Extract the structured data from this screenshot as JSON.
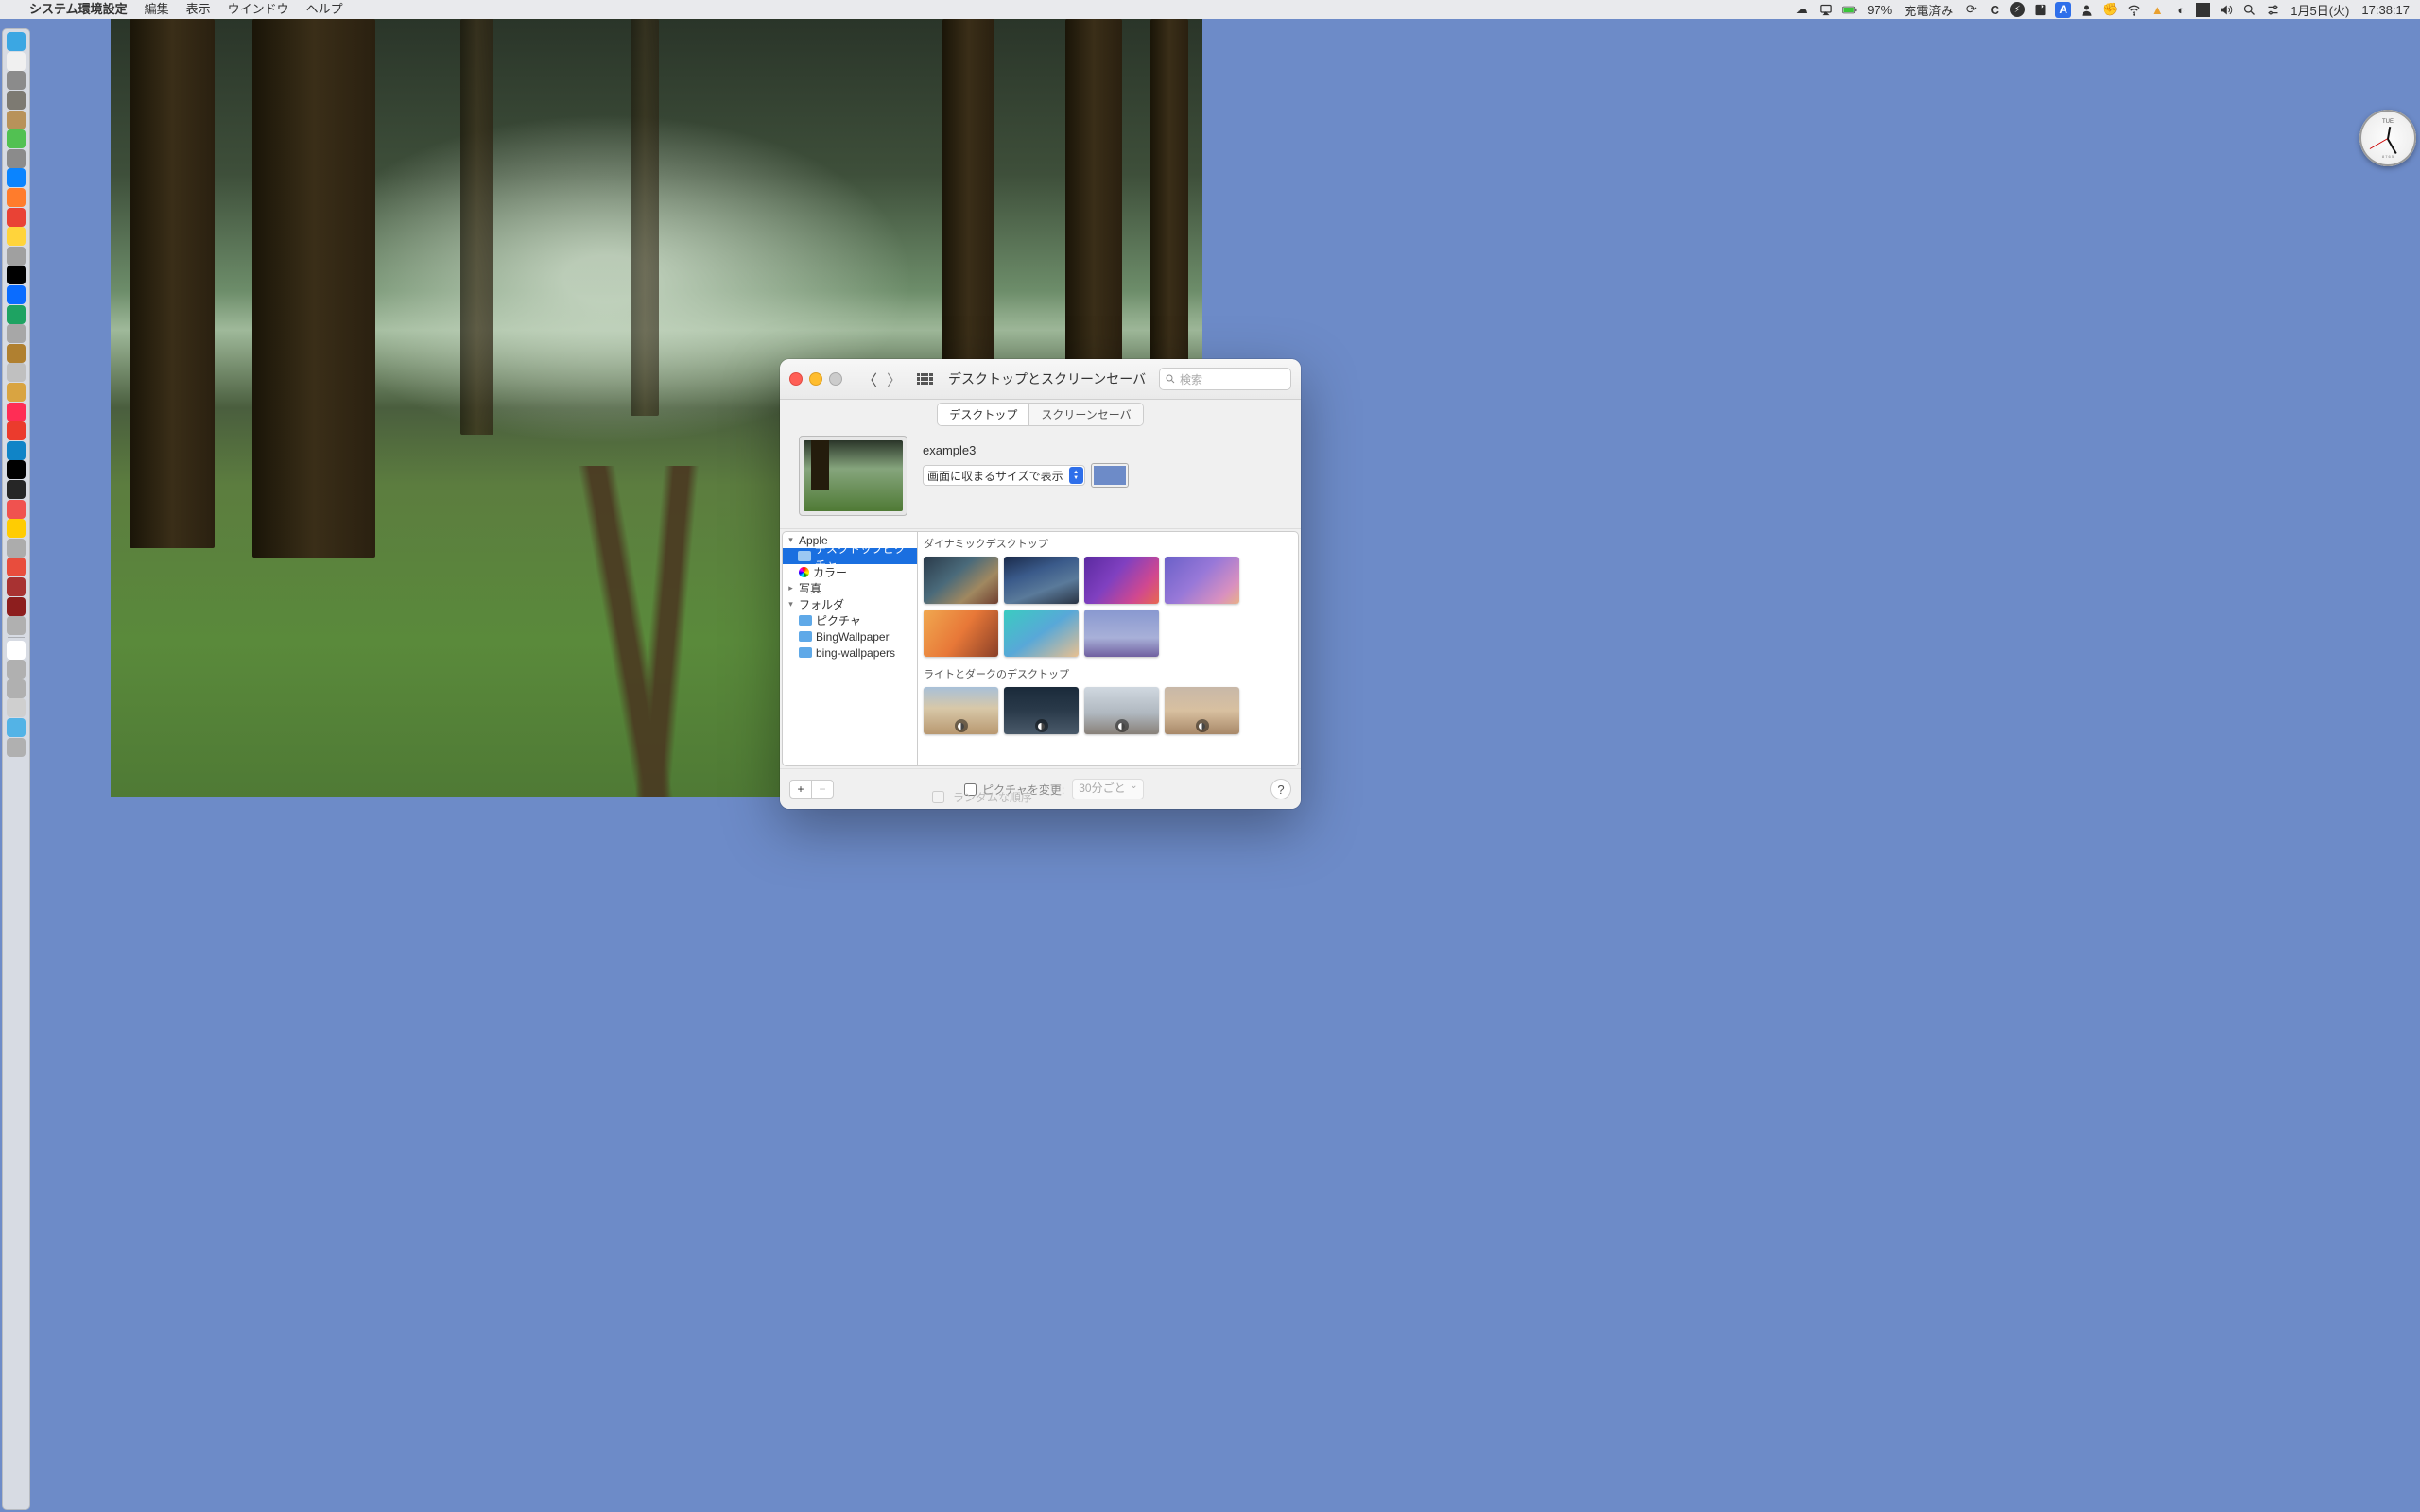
{
  "menubar": {
    "app_name": "システム環境設定",
    "menus": [
      "編集",
      "表示",
      "ウインドウ",
      "ヘルプ"
    ],
    "battery_pct": "97%",
    "battery_status": "充電済み",
    "input_badge": "A",
    "date": "1月5日(火)",
    "time": "17:38:17"
  },
  "clock_widget": {
    "day": "TUE",
    "brand": "8 7 6 5"
  },
  "window": {
    "title": "デスクトップとスクリーンセーバ",
    "search_placeholder": "検索",
    "tabs": {
      "desktop": "デスクトップ",
      "screensaver": "スクリーンセーバ"
    },
    "current": {
      "name": "example3",
      "fit_mode": "画面に収まるサイズで表示",
      "fill_color": "#6d8bc8"
    },
    "sidebar": {
      "apple": "Apple",
      "desktop_pictures": "デスクトップピクチャ",
      "colors": "カラー",
      "photos": "写真",
      "folders": "フォルダ",
      "pictures": "ピクチャ",
      "bingwallpaper": "BingWallpaper",
      "bing_wallpapers": "bing-wallpapers"
    },
    "gallery": {
      "dynamic_header": "ダイナミックデスクトップ",
      "light_dark_header": "ライトとダークのデスクトップ"
    },
    "footer": {
      "change_picture": "ピクチャを変更:",
      "interval": "30分ごと",
      "random": "ランダムな順序"
    }
  },
  "dock_colors": [
    "#3ba7e3",
    "#f0f0f0",
    "#8b8b8b",
    "#7d7a72",
    "#b8925a",
    "#52c152",
    "#8b8b8b",
    "#0a84ff",
    "#ff7c2c",
    "#e94235",
    "#ffd43b",
    "#a0a0a0",
    "#000000",
    "#0a6cff",
    "#1ea362",
    "#a7a7a7",
    "#b08030",
    "#c0c0c0",
    "#d9a441",
    "#ff2d55",
    "#eb3b2d",
    "#1084c7",
    "#000000",
    "#262626",
    "#f0524f",
    "#ffcc02",
    "#acacac",
    "#e84d3d",
    "#a83232",
    "#8d1e1e",
    "#b0b0b0",
    "#ffffff",
    "#b0b0b0",
    "#b0b0b0",
    "#cfcfcf",
    "#53b3e6",
    "#b0b0b0"
  ],
  "wallpapers": {
    "dynamic": [
      "linear-gradient(140deg,#2a3a4a,#4a6a7a 40%,#a08860 70%,#704030)",
      "linear-gradient(160deg,#1a2a4a,#3a5a8a 35%,#5a7a9a 65%,#2a3444)",
      "linear-gradient(130deg,#5b2aa0,#8040c0 40%,#d04890 75%,#e86850)",
      "linear-gradient(135deg,#6a60c8,#9878d8 45%,#d890c0 80%,#e8b088)",
      "linear-gradient(125deg,#f0a850,#e87838 50%,#8a4028)",
      "linear-gradient(145deg,#3accc0,#58a8d8 50%,#e8c090)",
      "linear-gradient(180deg,#8898d0,#a8b0d8 60%,#7060a0)"
    ],
    "light_dark": [
      "linear-gradient(#a8c0d8,#d8c8a8 45%,#b89870)",
      "linear-gradient(#1a2a3a,#2a3a4a 50%,#4a5a6a)",
      "linear-gradient(#d0d8e0,#b0b8c0 55%,#888078)",
      "linear-gradient(#c8b8a8,#d8c0a0 50%,#a88868)"
    ]
  }
}
